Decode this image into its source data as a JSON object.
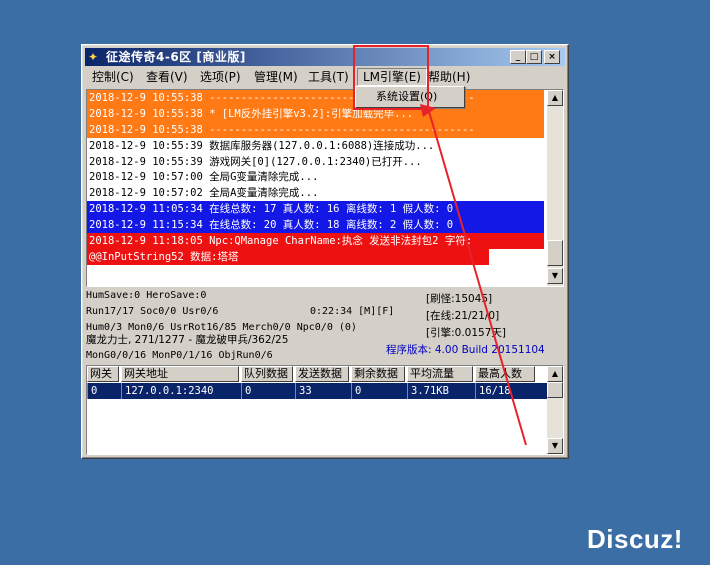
{
  "window": {
    "title": "征途传奇4-6区 [商业版]",
    "controls": [
      "_",
      "□",
      "×"
    ]
  },
  "menu": {
    "items": [
      "控制(C)",
      "查看(V)",
      "选项(P)",
      "管理(M)",
      "工具(T)",
      "LM引擎(E)",
      "帮助(H)"
    ],
    "open_item": "LM引擎(E)",
    "dropdown_options": [
      "系统设置(Q)"
    ]
  },
  "log": {
    "lines": [
      {
        "text": "2018-12-9 10:55:38 ------------------------------------------",
        "style": "orange"
      },
      {
        "text": "2018-12-9 10:55:38 * [LM反外挂引擎v3.2]:引擎加载完毕...",
        "style": "orange"
      },
      {
        "text": "2018-12-9 10:55:38 ------------------------------------------",
        "style": "orange"
      },
      {
        "text": "2018-12-9 10:55:39 数据库服务器(127.0.0.1:6088)连接成功...",
        "style": "plain"
      },
      {
        "text": "2018-12-9 10:55:39 游戏网关[0](127.0.0.1:2340)已打开...",
        "style": "plain"
      },
      {
        "text": "2018-12-9 10:57:00 全局G变量清除完成...",
        "style": "plain"
      },
      {
        "text": "2018-12-9 10:57:02 全局A变量清除完成...",
        "style": "plain"
      },
      {
        "text": "2018-12-9 11:05:34 在线总数: 17 真人数: 16 离线数: 1 假人数: 0",
        "style": "blue"
      },
      {
        "text": "2018-12-9 11:15:34 在线总数: 20 真人数: 18 离线数: 2 假人数: 0",
        "style": "blue"
      },
      {
        "text": "2018-12-9 11:18:05 Npc:QManage CharName:执念 发送非法封包2 字符:",
        "style": "red"
      },
      {
        "text": "@@InPutString52 数据:塔塔",
        "style": "red partial"
      }
    ]
  },
  "status": {
    "humsave": "HumSave:0 HeroSave:0",
    "run": "Run17/17 Soc0/0 Usr0/6",
    "time": "0:22:34 [M][F]",
    "hum": "Hum0/3 Mon0/6 UsrRot16/85 Merch0/0 Npc0/0 (0)",
    "mon1": "魔龙力士, 271/1277 - 魔龙破甲兵/362/25",
    "mon2": "MonG0/0/16 MonP0/1/16 ObjRun0/6",
    "refresh": "[刷怪:15045]",
    "online": "[在线:21/21/0]",
    "engine": "[引擎:0.0157天]",
    "version": "程序版本: 4.00 Build 20151104"
  },
  "gateway_table": {
    "headers": [
      "网关",
      "网关地址",
      "队列数据",
      "发送数据",
      "剩余数据",
      "平均流量",
      "最高人数"
    ],
    "rows": [
      [
        "0",
        "127.0.0.1:2340",
        "0",
        "33",
        "0",
        "3.71KB",
        "16/18"
      ]
    ]
  },
  "watermark": "Discuz!",
  "colors": {
    "desktop": "#3a6ea5",
    "orange": "#ff7a14",
    "blue": "#1418e6",
    "red": "#ee1111",
    "highlight_box": "#e8222a"
  }
}
